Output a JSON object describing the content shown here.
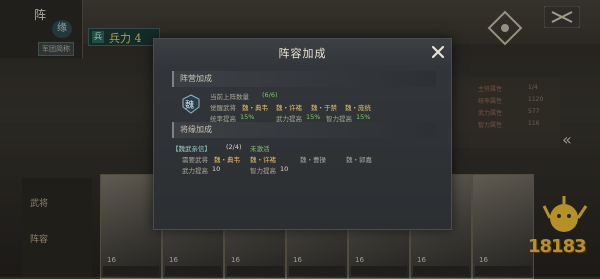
{
  "background": {
    "corner_char": "阵",
    "corner_char2": "缘",
    "corner_tag": "军团简称",
    "army_badge": "兵",
    "army_title": "兵力 4",
    "side_labels": [
      "武将",
      "阵容"
    ],
    "right_stats": [
      {
        "label": "主将属性",
        "value": "1/4"
      },
      {
        "label": "统率属性",
        "value": "1120"
      },
      {
        "label": "武力属性",
        "value": "577"
      },
      {
        "label": "智力属性",
        "value": "116"
      }
    ],
    "card_levels": [
      "16",
      "16",
      "16",
      "16",
      "16",
      "16",
      "16"
    ],
    "logo_text": "18183"
  },
  "modal": {
    "title": "阵容加成",
    "close_icon": "close-x-icon",
    "camp_section": {
      "heading": "阵营加成",
      "emblem_char": "魏",
      "count_label": "当前上阵数量",
      "count_value": "(6/6)",
      "generals_label": "觉醒武将",
      "generals": [
        "魏・典韦",
        "魏・许褚",
        "魏・于禁",
        "魏・庞统"
      ],
      "stats": [
        {
          "label": "统率提高",
          "value": "15%"
        },
        {
          "label": "武力提高",
          "value": "15%"
        },
        {
          "label": "智力提高",
          "value": "15%"
        }
      ]
    },
    "fate_section": {
      "heading": "将缘加成",
      "bond_name": "【魏武亲信】",
      "bond_progress": "(2/4)",
      "bond_status": "未激活",
      "generals_label": "需要武将",
      "generals": [
        "魏・典韦",
        "魏・许褚",
        "魏・曹操",
        "魏・郭嘉"
      ],
      "stats": [
        {
          "label": "武力提高",
          "value": "10"
        },
        {
          "label": "智力提高",
          "value": "10"
        }
      ]
    }
  },
  "colors": {
    "accent_green": "#7fc46a",
    "accent_yellow": "#e3c26e",
    "modal_bg": "#2f3236"
  }
}
